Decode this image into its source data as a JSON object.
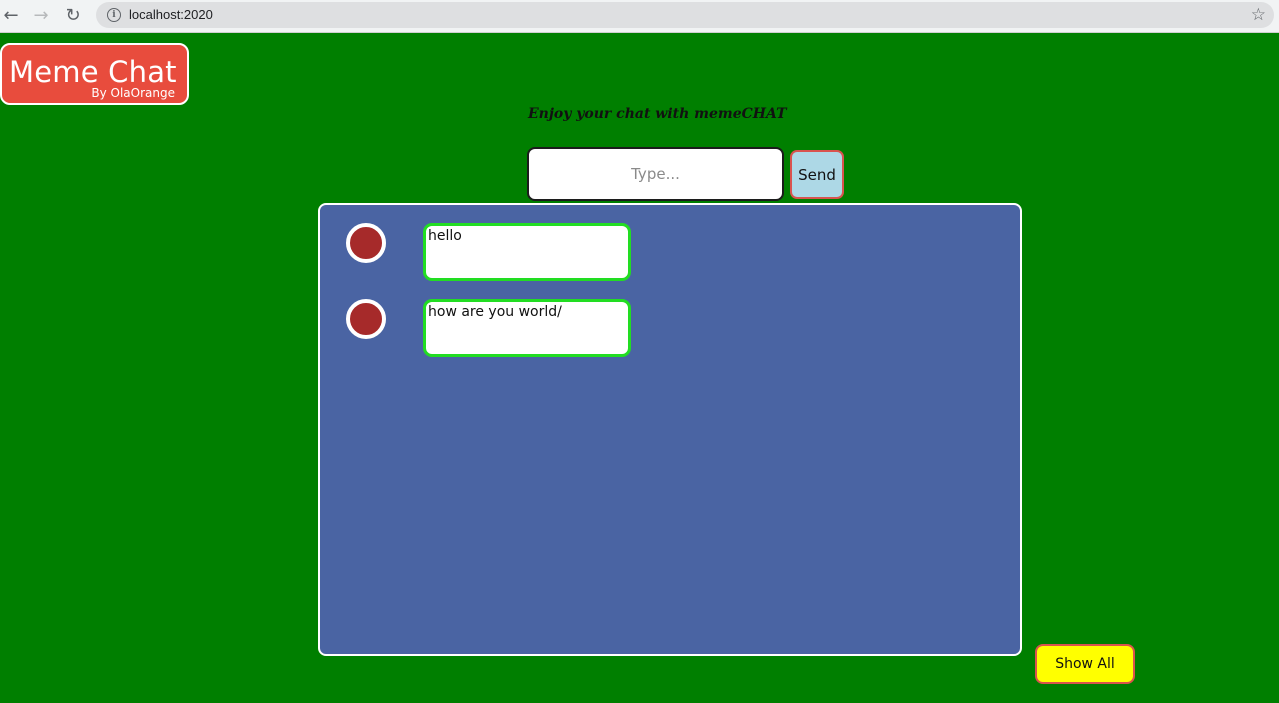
{
  "browser": {
    "url": "localhost:2020"
  },
  "header": {
    "logo_title": "Meme Chat",
    "logo_subtitle": "By OlaOrange",
    "tagline": "Enjoy your chat with memeCHAT"
  },
  "composer": {
    "placeholder": "Type...",
    "send_label": "Send"
  },
  "messages": [
    {
      "text": "hello"
    },
    {
      "text": "how are you world/"
    }
  ],
  "footer": {
    "show_all_label": "Show All"
  },
  "colors": {
    "page_background": "#007f00",
    "logo_background": "#e84c3d",
    "chat_panel": "#4a64a3",
    "avatar": "#a62a2a",
    "bubble_border": "#22dd22",
    "send_button": "#add8e6",
    "show_all_button": "#ffff00"
  }
}
